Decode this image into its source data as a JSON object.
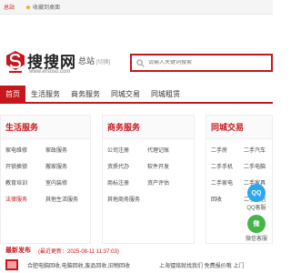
{
  "topbar": {
    "home_label": "总站",
    "fav_label": "收藏到桌面"
  },
  "header": {
    "logo_cn": "搜搜网",
    "logo_en": "www.ersoso.com",
    "site_name": "总站",
    "site_city": "[切换]",
    "search_placeholder": "请输入关键词搜索"
  },
  "nav": {
    "items": [
      {
        "label": "首页"
      },
      {
        "label": "生活服务"
      },
      {
        "label": "商务服务"
      },
      {
        "label": "同城交易"
      },
      {
        "label": "同城租赁"
      }
    ]
  },
  "categories": [
    {
      "title": "生活服务",
      "rows": [
        [
          "家电维修",
          "家政服务"
        ],
        [
          "开锁换锁",
          "搬家服务"
        ],
        [
          "教育培训",
          "室内装修"
        ],
        [
          "法律服务",
          "其他生活服务"
        ]
      ]
    },
    {
      "title": "商务服务",
      "rows": [
        [
          "公司注册",
          "代理记账"
        ],
        [
          "资质代办",
          "软件开发"
        ],
        [
          "商标注册",
          "资产评估"
        ],
        [
          "其他商务服务",
          ""
        ]
      ]
    },
    {
      "title": "同城交易",
      "rows": [
        [
          "二手房",
          "二手汽车"
        ],
        [
          "二手手机",
          "二手电脑"
        ],
        [
          "二手家电",
          "二手家具"
        ],
        [
          "回收",
          "二手其他"
        ]
      ]
    }
  ],
  "side": {
    "qq_label": "QQ客服",
    "wx_label": "微信客服",
    "qq_icon": "QQ",
    "wx_icon": "微"
  },
  "latest": {
    "label": "最新发布",
    "time": "(最近更新：2025-08-11 11:37:03)"
  },
  "bottom": {
    "item1": "合肥电脑回收,电脑回收,废品回收,旧物回收",
    "item2": "上海镭铭就找我们 免费报价哦 上门"
  },
  "colors": {
    "brand_red": "#c8161d",
    "qq_blue": "#2aa7f0",
    "wechat_green": "#44b549"
  }
}
